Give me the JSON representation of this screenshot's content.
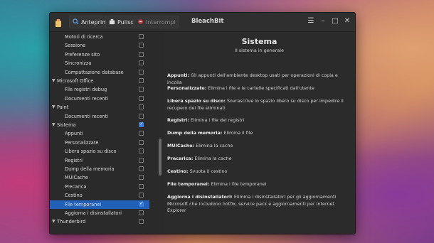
{
  "toolbar": {
    "preview_label": "Anteprima",
    "clean_label": "Pulisci",
    "stop_label": "Interrompi"
  },
  "window": {
    "title": "BleachBit"
  },
  "tree": [
    {
      "label": "Motori di ricerca",
      "checked": false,
      "indent": 1
    },
    {
      "label": "Sessione",
      "checked": false,
      "indent": 1
    },
    {
      "label": "Preferenze sito",
      "checked": false,
      "indent": 1
    },
    {
      "label": "Sincronizza",
      "checked": false,
      "indent": 1
    },
    {
      "label": "Compattazione database",
      "checked": false,
      "indent": 1
    },
    {
      "label": "Microsoft Office",
      "checked": false,
      "indent": 0,
      "expanded": true
    },
    {
      "label": "File registri debug",
      "checked": false,
      "indent": 1
    },
    {
      "label": "Documenti recenti",
      "checked": false,
      "indent": 1
    },
    {
      "label": "Paint",
      "checked": false,
      "indent": 0,
      "expanded": true
    },
    {
      "label": "Documenti recenti",
      "checked": false,
      "indent": 1
    },
    {
      "label": "Sistema",
      "checked": true,
      "indent": 0,
      "expanded": true
    },
    {
      "label": "Appunti",
      "checked": false,
      "indent": 1
    },
    {
      "label": "Personalizzate",
      "checked": false,
      "indent": 1
    },
    {
      "label": "Libera spazio su disco",
      "checked": false,
      "indent": 1
    },
    {
      "label": "Registri",
      "checked": false,
      "indent": 1
    },
    {
      "label": "Dump della memoria",
      "checked": false,
      "indent": 1
    },
    {
      "label": "MUICache",
      "checked": false,
      "indent": 1
    },
    {
      "label": "Precarica",
      "checked": false,
      "indent": 1
    },
    {
      "label": "Cestino",
      "checked": false,
      "indent": 1
    },
    {
      "label": "File temporanei",
      "checked": true,
      "indent": 1,
      "selected": true
    },
    {
      "label": "Aggiorna i disinstallatori",
      "checked": false,
      "indent": 1
    },
    {
      "label": "Thunderbird",
      "checked": false,
      "indent": 0,
      "expanded": true
    }
  ],
  "detail": {
    "title": "Sistema",
    "subtitle": "Il sistema in generale",
    "items": [
      {
        "name": "Appunti:",
        "desc": " Gli appunti dell'ambiente desktop usati per operazioni di copia e incolla"
      },
      {
        "name": "Personalizzate:",
        "desc": " Elimina i file e le cartelle specificati dall'utente"
      },
      {
        "name": "Libera spazio su disco:",
        "desc": " Sovrascrive lo spazio libero su disco per impedire il recupero dei file eliminati"
      },
      {
        "name": "Registri:",
        "desc": " Elimina i file dei registri"
      },
      {
        "name": "Dump della memoria:",
        "desc": " Elimina il file"
      },
      {
        "name": "MUICache:",
        "desc": " Elimina la cache"
      },
      {
        "name": "Precarica:",
        "desc": " Elimina la cache"
      },
      {
        "name": "Cestino:",
        "desc": " Svuota il cestino"
      },
      {
        "name": "File temporanei:",
        "desc": " Elimina i file temporanei"
      },
      {
        "name": "Aggiorna i disinstallatori:",
        "desc": " Elimina i disinstallatori per gli aggiornamenti Microsoft che includono hotfix, service pack e aggiornamenti per Internet Explorer"
      }
    ]
  },
  "colors": {
    "selection": "#2360b8",
    "checkbox_checked": "#3a7be0"
  }
}
